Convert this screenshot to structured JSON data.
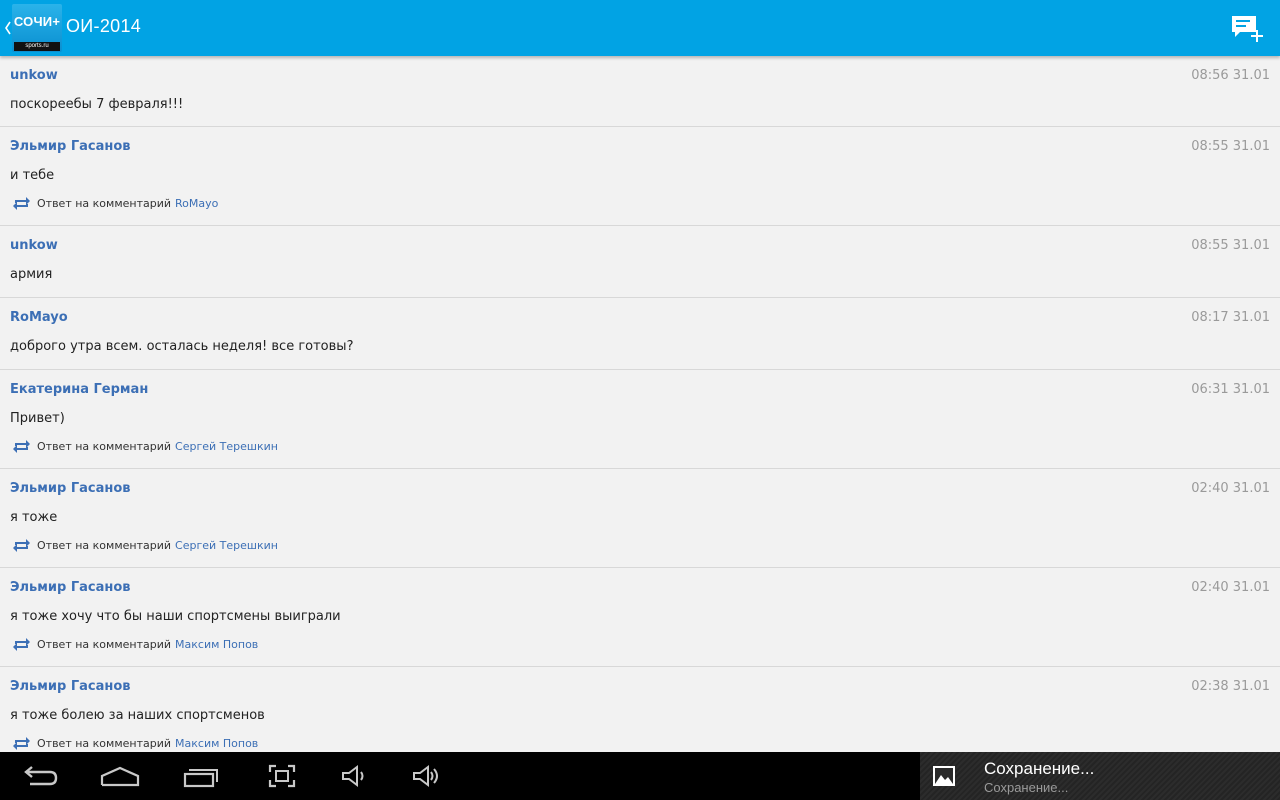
{
  "app": {
    "logo_text": "СОЧИ+",
    "logo_subtext": "sports.ru",
    "title": "ОИ-2014"
  },
  "colors": {
    "actionbar": "#01a3e4",
    "author": "#3c6fb5",
    "background": "#f2f2f2"
  },
  "icons": {
    "up": "chevron-left-icon",
    "add_comment": "add-comment-icon",
    "reply": "reply-repeat-icon"
  },
  "reply_prefix": "Ответ на комментарий",
  "comments": [
    {
      "author": "unkow",
      "time": "08:56 31.01",
      "text": "поскореебы 7 февраля!!!",
      "reply_to": ""
    },
    {
      "author": "Эльмир Гасанов",
      "time": "08:55 31.01",
      "text": "и тебе",
      "reply_to": "RoMayo"
    },
    {
      "author": "unkow",
      "time": "08:55 31.01",
      "text": "армия",
      "reply_to": ""
    },
    {
      "author": "RoMayo",
      "time": "08:17 31.01",
      "text": "доброго утра всем. осталась неделя! все готовы?",
      "reply_to": ""
    },
    {
      "author": "Екатерина Герман",
      "time": "06:31 31.01",
      "text": "Привет)",
      "reply_to": "Сергей Терешкин"
    },
    {
      "author": "Эльмир Гасанов",
      "time": "02:40 31.01",
      "text": "я тоже",
      "reply_to": "Сергей Терешкин"
    },
    {
      "author": "Эльмир Гасанов",
      "time": "02:40 31.01",
      "text": "я тоже хочу что бы наши спортсмены выиграли",
      "reply_to": "Максим Попов"
    },
    {
      "author": "Эльмир Гасанов",
      "time": "02:38 31.01",
      "text": "я тоже болею за наших спортсменов",
      "reply_to": "Максим Попов"
    }
  ],
  "navbar": {
    "buttons": [
      "back-icon",
      "home-icon",
      "recent-apps-icon",
      "screenshot-icon",
      "volume-down-icon",
      "volume-up-icon"
    ]
  },
  "notification": {
    "title": "Сохранение...",
    "subtitle": "Сохранение...",
    "icon": "image-icon"
  }
}
